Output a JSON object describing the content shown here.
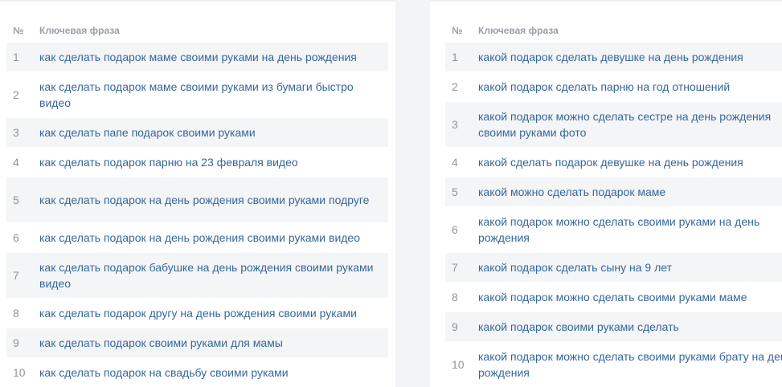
{
  "left_table": {
    "header": {
      "num": "№",
      "phrase": "Ключевая фраза"
    },
    "rows": [
      {
        "num": "1",
        "phrase": "как сделать подарок маме своими руками на день рождения"
      },
      {
        "num": "2",
        "phrase": "как сделать подарок маме своими руками из бумаги быстро видео"
      },
      {
        "num": "3",
        "phrase": "как сделать папе подарок своими руками"
      },
      {
        "num": "4",
        "phrase": "как сделать подарок парню на 23 февраля видео"
      },
      {
        "num": "5",
        "phrase": "как сделать подарок на день рождения своими руками подруге"
      },
      {
        "num": "6",
        "phrase": "как сделать подарок на день рождения своими руками видео"
      },
      {
        "num": "7",
        "phrase": "как сделать подарок бабушке на день рождения своими руками видео"
      },
      {
        "num": "8",
        "phrase": "как сделать подарок другу на день рождения своими руками"
      },
      {
        "num": "9",
        "phrase": "как сделать подарок своими руками для мамы"
      },
      {
        "num": "10",
        "phrase": "как сделать подарок на свадьбу своими руками"
      }
    ]
  },
  "right_table": {
    "header": {
      "num": "№",
      "phrase": "Ключевая фраза"
    },
    "rows": [
      {
        "num": "1",
        "phrase": "какой подарок сделать девушке на день рождения"
      },
      {
        "num": "2",
        "phrase": "какой подарок сделать парню на год отношений"
      },
      {
        "num": "3",
        "phrase": "какой подарок можно сделать сестре на день рождения своими руками фото"
      },
      {
        "num": "4",
        "phrase": "какой сделать подарок девушке на день рождения"
      },
      {
        "num": "5",
        "phrase": "какой можно сделать подарок маме"
      },
      {
        "num": "6",
        "phrase": "какой подарок можно сделать своими руками на день рождения"
      },
      {
        "num": "7",
        "phrase": "какой подарок сделать сыну на 9 лет"
      },
      {
        "num": "8",
        "phrase": "какой подарок можно сделать своими руками маме"
      },
      {
        "num": "9",
        "phrase": "какой подарок своими руками сделать"
      },
      {
        "num": "10",
        "phrase": "какой подарок можно сделать своими руками брату на день рождения"
      }
    ]
  }
}
